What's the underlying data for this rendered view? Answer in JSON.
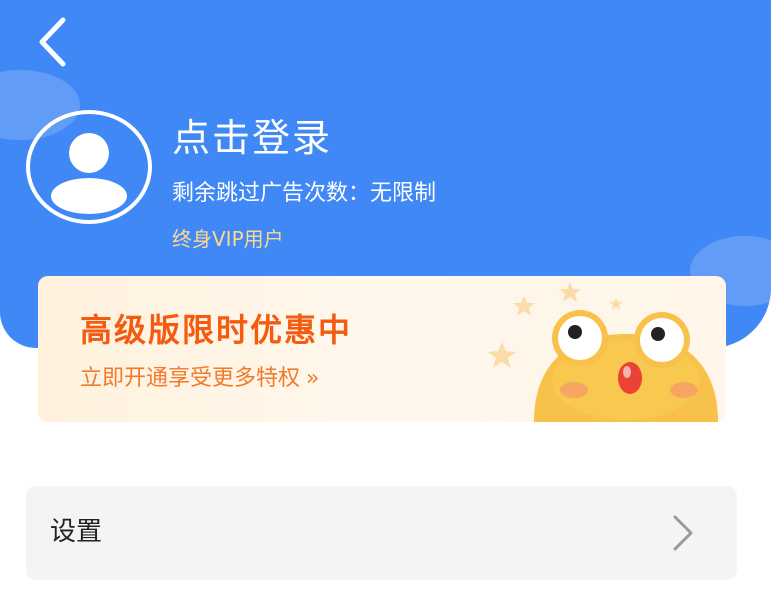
{
  "colors": {
    "header_blue": "#3f88f5",
    "vip_gold": "#ffd98e",
    "promo_orange": "#f35c10",
    "settings_bg": "#f3f4f6"
  },
  "icons": {
    "back": "chevron-left-icon",
    "avatar": "user-icon",
    "settings_arrow": "chevron-right-icon"
  },
  "profile": {
    "login_prompt": "点击登录",
    "ad_skip_label": "剩余跳过广告次数",
    "ad_skip_separator": "：",
    "ad_skip_value": "无限制",
    "membership": "终身VIP用户"
  },
  "promo": {
    "title": "高级版限时优惠中",
    "subtitle": "立即开通享受更多特权",
    "chevron": "»"
  },
  "menu": {
    "settings_label": "设置"
  }
}
